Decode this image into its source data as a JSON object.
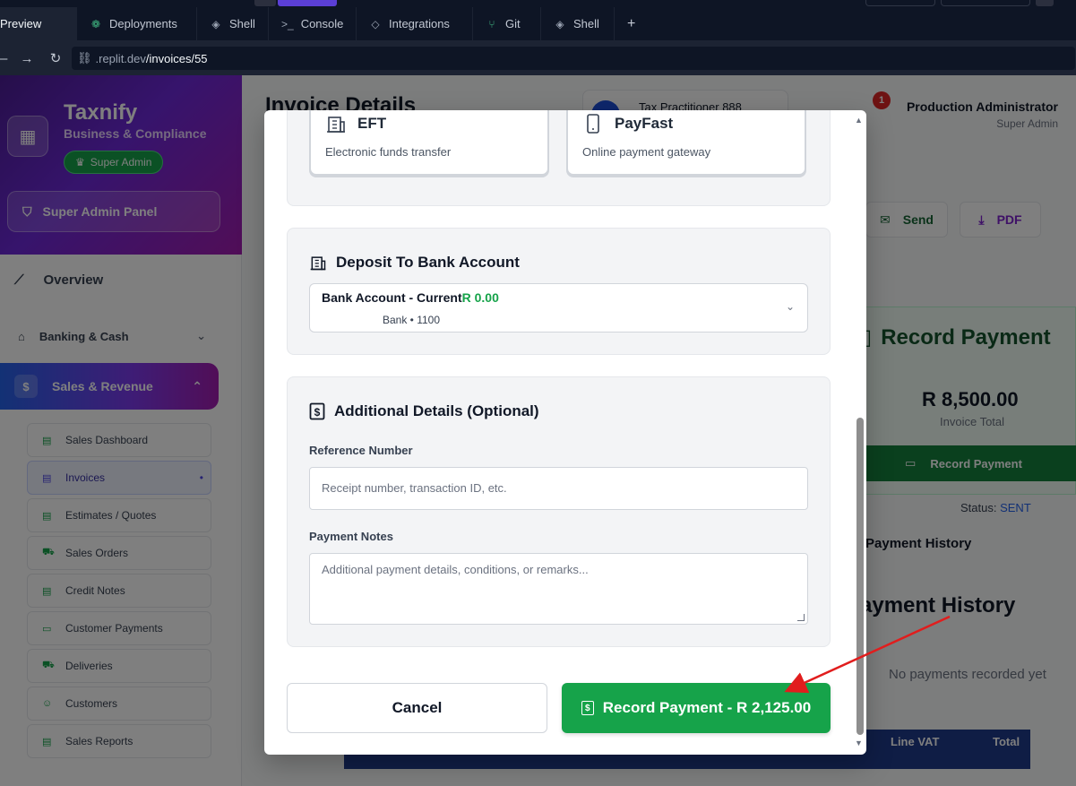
{
  "ide": {
    "tabs": [
      {
        "label": "Preview",
        "icon": "preview-icon"
      },
      {
        "label": "Deployments",
        "icon": "deployments-icon"
      },
      {
        "label": "Shell",
        "icon": "shell-icon"
      },
      {
        "label": "Console",
        "icon": "console-icon"
      },
      {
        "label": "Integrations",
        "icon": "integrations-icon"
      },
      {
        "label": "Git",
        "icon": "git-icon"
      },
      {
        "label": "Shell",
        "icon": "shell-icon"
      }
    ],
    "new_tab": "+",
    "url_host": ".replit.dev",
    "url_path": "/invoices/55"
  },
  "sidebar": {
    "brand_name": "Taxnify",
    "brand_sub": "Business & Compliance",
    "badge": "Super Admin",
    "admin_panel": "Super Admin Panel",
    "overview": "Overview",
    "banking": "Banking & Cash",
    "sales": "Sales & Revenue",
    "sub_items": [
      {
        "label": "Sales Dashboard"
      },
      {
        "label": "Invoices"
      },
      {
        "label": "Estimates / Quotes"
      },
      {
        "label": "Sales Orders"
      },
      {
        "label": "Credit Notes"
      },
      {
        "label": "Customer Payments"
      },
      {
        "label": "Deliveries"
      },
      {
        "label": "Customers"
      },
      {
        "label": "Sales Reports"
      }
    ]
  },
  "header": {
    "page_title": "Invoice Details",
    "practitioner": "Tax Practitioner 888",
    "notif_count": "1",
    "user_name": "Production Administrator",
    "user_role": "Super Admin"
  },
  "actions": {
    "send": "Send",
    "pdf": "PDF"
  },
  "record_card": {
    "title": "Record Payment",
    "amount": "R 8,500.00",
    "amount_label": "Invoice Total",
    "button": "Record Payment",
    "status_label": "Status:",
    "status_value": "SENT"
  },
  "payment_history": {
    "tab": "Payment History",
    "title": "ayment History",
    "empty": "No payments recorded yet"
  },
  "table": {
    "col_vat": "Line VAT",
    "col_total": "Total"
  },
  "modal": {
    "methods": [
      {
        "name": "EFT",
        "description": "Electronic funds transfer",
        "icon": "bank-building-icon"
      },
      {
        "name": "PayFast",
        "description": "Online payment gateway",
        "icon": "mobile-phone-icon"
      }
    ],
    "bank_section_title": "Deposit To Bank Account",
    "bank_account": {
      "name": "Bank Account - Current",
      "balance": "R 0.00",
      "meta": "Bank • 1100"
    },
    "details_section_title": "Additional Details (Optional)",
    "reference_label": "Reference Number",
    "reference_placeholder": "Receipt number, transaction ID, etc.",
    "notes_label": "Payment Notes",
    "notes_placeholder": "Additional payment details, conditions, or remarks...",
    "cancel_label": "Cancel",
    "submit_label": "Record Payment - R 2,125.00"
  },
  "colors": {
    "primary_green": "#16a34a",
    "annotation_arrow": "#e11d1d",
    "overlay": "rgba(0,0,0,0.5)"
  }
}
